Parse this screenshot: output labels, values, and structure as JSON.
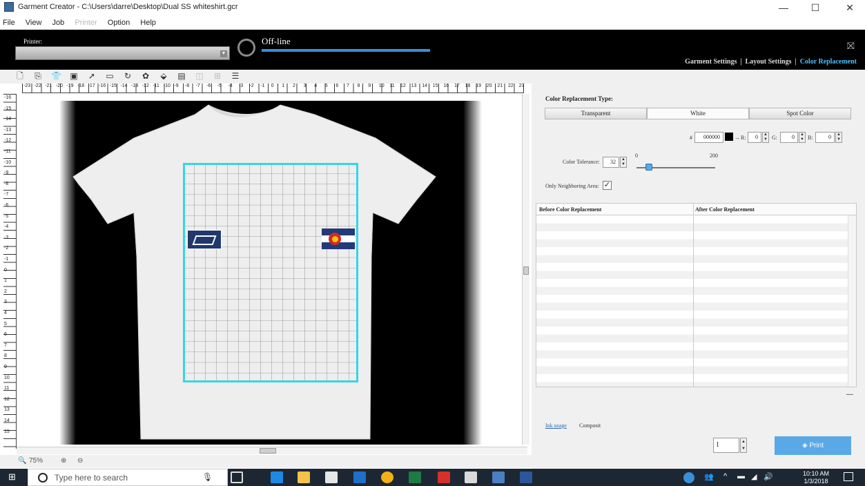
{
  "window": {
    "title": "Garment Creator - C:\\Users\\darre\\Desktop\\Dual SS whiteshirt.gcr",
    "minimize": "—",
    "maximize": "☐",
    "close": "✕"
  },
  "menu": [
    "File",
    "View",
    "Job",
    "Printer",
    "Option",
    "Help"
  ],
  "header": {
    "printer_label": "Printer:",
    "printer_value": "",
    "status": "Off-line",
    "tabs": [
      "Garment Settings",
      "Layout Settings",
      "Color Replacement"
    ],
    "active_tab": "Color Replacement"
  },
  "toolbar": {
    "icons": [
      "new-icon",
      "open-icon",
      "garment-icon",
      "save-icon",
      "pointer-icon",
      "rectangle-icon",
      "rotate-icon",
      "palette-icon",
      "paint-bucket-icon",
      "layers-icon",
      "align-icon",
      "distribute-icon",
      "list-icon"
    ]
  },
  "ruler": {
    "horizontal": [
      "-23",
      "-22",
      "-21",
      "-20",
      "-19",
      "-18",
      "-17",
      "-16",
      "-15",
      "-14",
      "-13",
      "-12",
      "-11",
      "-10",
      "-9",
      "-8",
      "-7",
      "-6",
      "-5",
      "-4",
      "-3",
      "-2",
      "-1",
      "0",
      "1",
      "2",
      "3",
      "4",
      "5",
      "6",
      "7",
      "8",
      "9",
      "10",
      "11",
      "12",
      "13",
      "14",
      "15",
      "16",
      "17",
      "18",
      "19",
      "20",
      "21",
      "22",
      "23"
    ],
    "vertical": [
      "-16",
      "-15",
      "-14",
      "-13",
      "-12",
      "-11",
      "-10",
      "-9",
      "-8",
      "-7",
      "-6",
      "-5",
      "-4",
      "-3",
      "-2",
      "-1",
      "0",
      "1",
      "2",
      "3",
      "4",
      "5",
      "6",
      "7",
      "8",
      "9",
      "10",
      "11",
      "12",
      "13",
      "14",
      "15"
    ]
  },
  "zoom": {
    "value": "75%"
  },
  "color_replacement": {
    "type_label": "Color Replacement Type:",
    "types": [
      "Transparent",
      "White",
      "Spot Color"
    ],
    "hex": "000000",
    "r_label": "R:",
    "r": "0",
    "g_label": "G:",
    "g": "0",
    "b_label": "B:",
    "b": "0",
    "tolerance_label": "Color Tolerance:",
    "tolerance": "32",
    "slider_min": "0",
    "slider_max": "200",
    "tolerance_fraction": 0.16,
    "neighboring_label": "Only Neighboring Area:",
    "neighboring_checked": true,
    "table_headers": [
      "Before Color Replacement",
      "After Color Replacement"
    ],
    "ink_label": "Ink usage",
    "composite_label": "Composit",
    "copies": "1",
    "print_label": "Print"
  },
  "colors": {
    "accent": "#4ec0ff",
    "print_button": "#5aa9e6",
    "header_bg": "#000000",
    "status_bar": "#3b8fd6",
    "guide_frame": "#33d6e8"
  },
  "taskbar": {
    "search_placeholder": "Type here to search",
    "apps": [
      "microphone-icon",
      "task-view-icon",
      "edge-icon",
      "file-explorer-icon",
      "store-icon",
      "outlook-icon",
      "chrome-icon",
      "excel-icon",
      "acrobat-icon",
      "garment-creator-icon",
      "photos-icon",
      "word-icon"
    ],
    "time": "10:10 AM",
    "date": "1/3/2018"
  }
}
